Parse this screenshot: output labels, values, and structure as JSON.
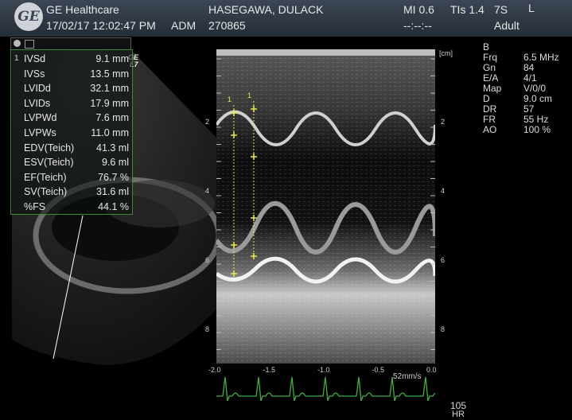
{
  "header": {
    "brand": "GE Healthcare",
    "logo_text": "GE",
    "datetime": "17/02/17 12:02:47 PM",
    "user": "ADM",
    "patient_name": "HASEGAWA, DULACK",
    "patient_id": "270865",
    "mi": "MI 0.6",
    "tis": "TIs 1.4",
    "probe": "7S",
    "probe_side": "L",
    "dashes": "--:--:--",
    "patient_type": "Adult"
  },
  "probe_label": "GE",
  "probe_label2": "L7",
  "measurements": {
    "marker": "1",
    "rows": [
      {
        "label": "IVSd",
        "value": "9.1 mm"
      },
      {
        "label": "IVSs",
        "value": "13.5 mm"
      },
      {
        "label": "LVIDd",
        "value": "32.1 mm"
      },
      {
        "label": "LVIDs",
        "value": "17.9 mm"
      },
      {
        "label": "LVPWd",
        "value": "7.6 mm"
      },
      {
        "label": "LVPWs",
        "value": "11.0 mm"
      },
      {
        "label": "EDV(Teich)",
        "value": "41.3 ml"
      },
      {
        "label": "ESV(Teich)",
        "value": "9.6 ml"
      },
      {
        "label": "EF(Teich)",
        "value": "76.7 %"
      },
      {
        "label": "SV(Teich)",
        "value": "31.6 ml"
      },
      {
        "label": "%FS",
        "value": "44.1 %"
      }
    ]
  },
  "params": {
    "mode": "B",
    "rows": [
      {
        "label": "Frq",
        "value": "6.5 MHz"
      },
      {
        "label": "Gn",
        "value": "84"
      },
      {
        "label": "E/A",
        "value": "4/1"
      },
      {
        "label": "Map",
        "value": "V/0/0"
      },
      {
        "label": "D",
        "value": "9.0 cm"
      },
      {
        "label": "DR",
        "value": "57"
      },
      {
        "label": "FR",
        "value": "55 Hz"
      },
      {
        "label": "AO",
        "value": "100 %"
      }
    ]
  },
  "mmode": {
    "depth_unit": "[cm]",
    "depth_labels": [
      "2",
      "4",
      "6",
      "8"
    ],
    "time_labels": [
      "-2.0",
      "-1.5",
      "-1.0",
      "-0.5",
      "0.0"
    ],
    "sweep_speed": "52mm/s",
    "caliper_labels": [
      "1",
      "1"
    ]
  },
  "heart_rate": {
    "value": "105",
    "label": "HR"
  },
  "colors": {
    "caliper": "#e8e84a",
    "ecg": "#3fae3f",
    "panel_border": "#3a8a3a"
  }
}
